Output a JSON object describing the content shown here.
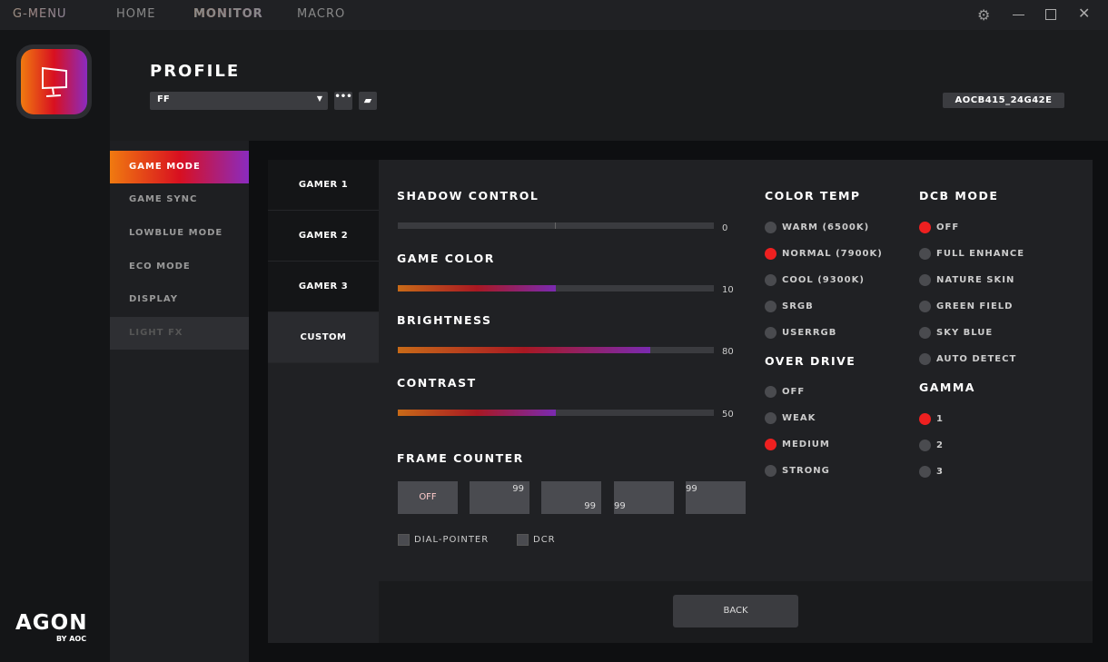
{
  "titlebar": {
    "brand": "G-MENU",
    "tabs": [
      "HOME",
      "MONITOR",
      "MACRO"
    ],
    "active_tab": "MONITOR"
  },
  "logo": {
    "text": "AGON",
    "sub": "BY AOC"
  },
  "profile": {
    "title": "PROFILE",
    "selected": "FF",
    "device": "AOCB415_24G42E"
  },
  "menu": [
    "GAME MODE",
    "GAME SYNC",
    "LOWBLUE MODE",
    "ECO MODE",
    "DISPLAY",
    "LIGHT FX"
  ],
  "tabs": [
    "GAMER 1",
    "GAMER 2",
    "GAMER 3",
    "CUSTOM"
  ],
  "sliders": [
    {
      "label": "SHADOW CONTROL",
      "value": "0",
      "fraction": 0
    },
    {
      "label": "GAME COLOR",
      "value": "10",
      "fraction": 0.5
    },
    {
      "label": "BRIGHTNESS",
      "value": "80",
      "fraction": 0.8
    },
    {
      "label": "CONTRAST",
      "value": "50",
      "fraction": 0.5
    }
  ],
  "frame_counter": {
    "label": "FRAME COUNTER",
    "off": "OFF",
    "values": [
      "99",
      "99",
      "99",
      "99"
    ]
  },
  "checkboxes": [
    "DIAL-POINTER",
    "DCR"
  ],
  "color_temp": {
    "label": "COLOR TEMP",
    "options": [
      "WARM (6500K)",
      "NORMAL (7900K)",
      "COOL (9300K)",
      "SRGB",
      "USERRGB"
    ],
    "selected": 1
  },
  "over_drive": {
    "label": "OVER DRIVE",
    "options": [
      "OFF",
      "WEAK",
      "MEDIUM",
      "STRONG"
    ],
    "selected": 2
  },
  "dcb_mode": {
    "label": "DCB MODE",
    "options": [
      "OFF",
      "FULL ENHANCE",
      "NATURE SKIN",
      "GREEN FIELD",
      "SKY BLUE",
      "AUTO DETECT"
    ],
    "selected": 0
  },
  "gamma": {
    "label": "GAMMA",
    "options": [
      "1",
      "2",
      "3"
    ],
    "selected": 0
  },
  "back": "BACK"
}
